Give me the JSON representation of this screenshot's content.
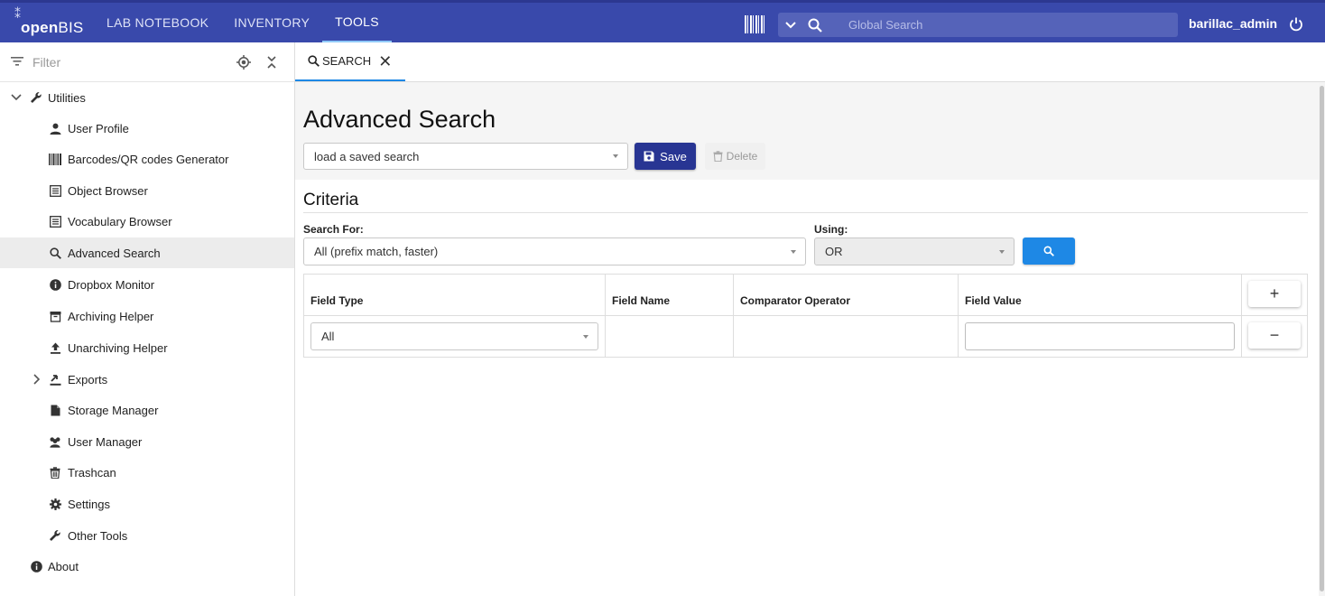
{
  "app": {
    "logo_text_bold": "open",
    "logo_text_regular": "BIS",
    "nav": [
      {
        "label": "LAB NOTEBOOK",
        "active": false
      },
      {
        "label": "INVENTORY",
        "active": false
      },
      {
        "label": "TOOLS",
        "active": true
      }
    ],
    "global_search_placeholder": "Global Search",
    "username": "barillac_admin",
    "icons": [
      "barcode-icon",
      "chevron-down-icon",
      "search-icon",
      "power-icon"
    ],
    "colors": {
      "topbar": "#3949ab",
      "save_button": "#283593",
      "search_button": "#1e88e5",
      "tab_indicator": "#1e88e5"
    }
  },
  "sidebar": {
    "filter_placeholder": "Filter",
    "items": [
      {
        "label": "Utilities",
        "icon": "wrench-icon",
        "expanded": true
      },
      {
        "label": "User Profile",
        "icon": "person-icon"
      },
      {
        "label": "Barcodes/QR codes Generator",
        "icon": "barcode-icon"
      },
      {
        "label": "Object Browser",
        "icon": "list-icon"
      },
      {
        "label": "Vocabulary Browser",
        "icon": "list-icon"
      },
      {
        "label": "Advanced Search",
        "icon": "search-icon",
        "selected": true
      },
      {
        "label": "Dropbox Monitor",
        "icon": "info-icon"
      },
      {
        "label": "Archiving Helper",
        "icon": "archive-icon"
      },
      {
        "label": "Unarchiving Helper",
        "icon": "upload-icon"
      },
      {
        "label": "Exports",
        "icon": "export-icon",
        "expanded": false
      },
      {
        "label": "Storage Manager",
        "icon": "file-icon"
      },
      {
        "label": "User Manager",
        "icon": "people-icon"
      },
      {
        "label": "Trashcan",
        "icon": "trash-icon"
      },
      {
        "label": "Settings",
        "icon": "gear-icon"
      },
      {
        "label": "Other Tools",
        "icon": "wrench-icon"
      },
      {
        "label": "About",
        "icon": "info-icon"
      }
    ]
  },
  "tabs": [
    {
      "label": "SEARCH",
      "active": true
    }
  ],
  "main": {
    "title": "Advanced Search",
    "saved_search_placeholder": "load a saved search",
    "save_label": "Save",
    "delete_label": "Delete",
    "criteria_title": "Criteria",
    "search_for_label": "Search For:",
    "search_for_value": "All (prefix match, faster)",
    "using_label": "Using:",
    "using_value": "OR",
    "table": {
      "headers": [
        "Field Type",
        "Field Name",
        "Comparator Operator",
        "Field Value"
      ],
      "rows": [
        {
          "field_type": "All",
          "field_name": "",
          "comparator": "",
          "field_value": ""
        }
      ],
      "add_label": "+",
      "remove_label": "−"
    }
  }
}
